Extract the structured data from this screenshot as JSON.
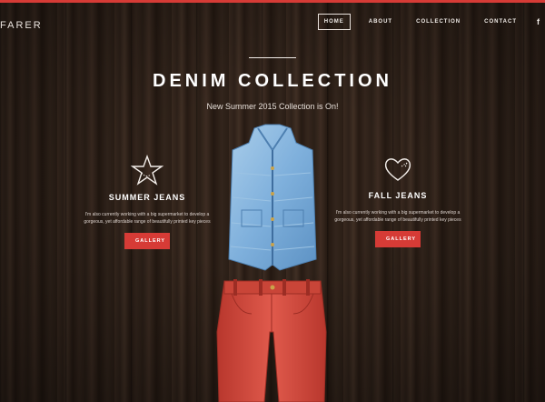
{
  "brand": {
    "logo": "FARER"
  },
  "nav": {
    "items": [
      {
        "label": "HOME",
        "active": true
      },
      {
        "label": "ABOUT",
        "active": false
      },
      {
        "label": "COLLECTION",
        "active": false
      },
      {
        "label": "CONTACT",
        "active": false
      }
    ],
    "social_icon": "f"
  },
  "hero": {
    "title": "DENIM COLLECTION",
    "subtitle": "New Summer 2015 Collection is On!"
  },
  "features": [
    {
      "icon": "star-icon",
      "title": "SUMMER JEANS",
      "text": "I'm also currently working with a big supermarket to develop a gorgeous, yet affordable range of beautifully printed key pieces",
      "button": "GALLERY"
    },
    {
      "icon": "heart-icon",
      "title": "FALL JEANS",
      "text": "I'm also currently working with a big supermarket to develop a gorgeous, yet affordable range of beautifully printed key pieces",
      "button": "GALLERY"
    }
  ],
  "colors": {
    "accent": "#d63b36",
    "wood": "#2e2119",
    "vest": "#7fb0dc",
    "pants": "#d24a3e"
  }
}
